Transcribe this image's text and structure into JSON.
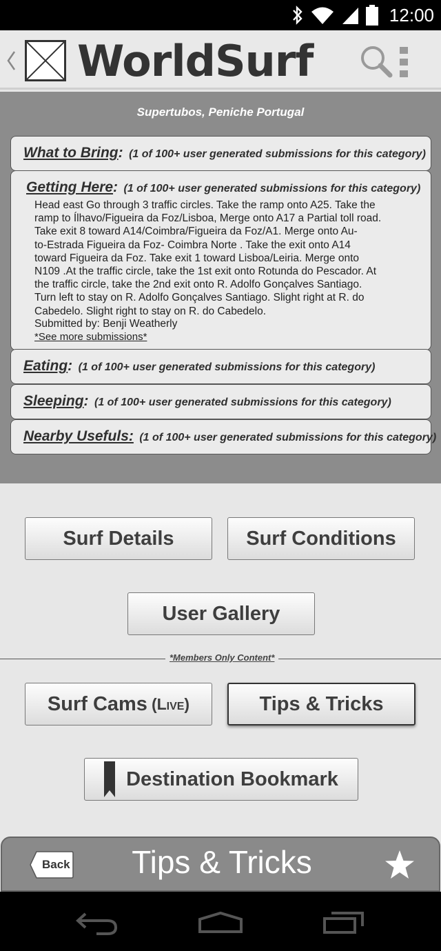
{
  "status_bar": {
    "time": "12:00",
    "icons": [
      "bluetooth-icon",
      "wifi-icon",
      "signal-icon",
      "battery-icon"
    ]
  },
  "app_bar": {
    "title": "WorldSurf",
    "icons": [
      "back-chevron-icon",
      "logo-placeholder-icon",
      "search-icon",
      "overflow-menu-icon"
    ]
  },
  "location": "Supertubos, Peniche Portugal",
  "categories": [
    {
      "name": "What to Bring",
      "colon": ":",
      "count": "(1 of 100+ user generated submissions for this category)"
    },
    {
      "name": "Getting Here",
      "colon": ":",
      "count": "(1 of 100+ user generated submissions for this category)"
    },
    {
      "name": "Eating",
      "colon": ":",
      "count": "(1 of 100+ user generated submissions for this category)"
    },
    {
      "name": "Sleeping",
      "colon": ":",
      "count": "(1 of 100+ user generated submissions for this category)"
    },
    {
      "name": "Nearby Usefuls:",
      "colon": "",
      "count": "(1 of 100+ user generated submissions for this category)"
    }
  ],
  "getting_here": {
    "lines": [
      "Head east Go through 3 traffic circles. Take the ramp onto A25. Take the",
      "ramp to Ílhavo/Figueira da Foz/Lisboa, Merge onto A17 a Partial toll road.",
      "Take exit 8 toward A14/Coimbra/Figueira da Foz/A1. Merge onto Au-",
      "to-Estrada Figueira da Foz- Coimbra Norte . Take the exit onto A14",
      "toward Figueira da Foz. Take exit 1 toward Lisboa/Leiria. Merge onto",
      "N109 .At the traffic circle, take the 1st exit onto Rotunda do Pescador. At",
      "the traffic circle, take the 2nd exit onto R. Adolfo Gonçalves Santiago.",
      "Turn left to stay on R. Adolfo Gonçalves Santiago. Slight right at R. do",
      "Cabedelo. Slight right to stay on R. do Cabedelo."
    ],
    "submitted_by": "Submitted by: Benji Weatherly",
    "see_more": "*See more submissions*"
  },
  "buttons": {
    "surf_details": "Surf Details",
    "surf_conditions": "Surf Conditions",
    "user_gallery": "User Gallery",
    "surf_cams": "Surf Cams",
    "surf_cams_live": "(Live)",
    "tips_tricks": "Tips & Tricks",
    "destination_bookmark": "Destination Bookmark"
  },
  "members_only": "*Members Only Content*",
  "banner": {
    "back_label": "Back",
    "title": "Tips & Tricks",
    "star_icon": "star-icon"
  },
  "nav_bar": {
    "icons": [
      "back-nav-icon",
      "home-nav-icon",
      "recents-nav-icon"
    ]
  },
  "colors": {
    "panel_gray": "#8c8c8c",
    "banner_gray": "#8a8a8a",
    "page_bg": "#e7e7e7"
  }
}
